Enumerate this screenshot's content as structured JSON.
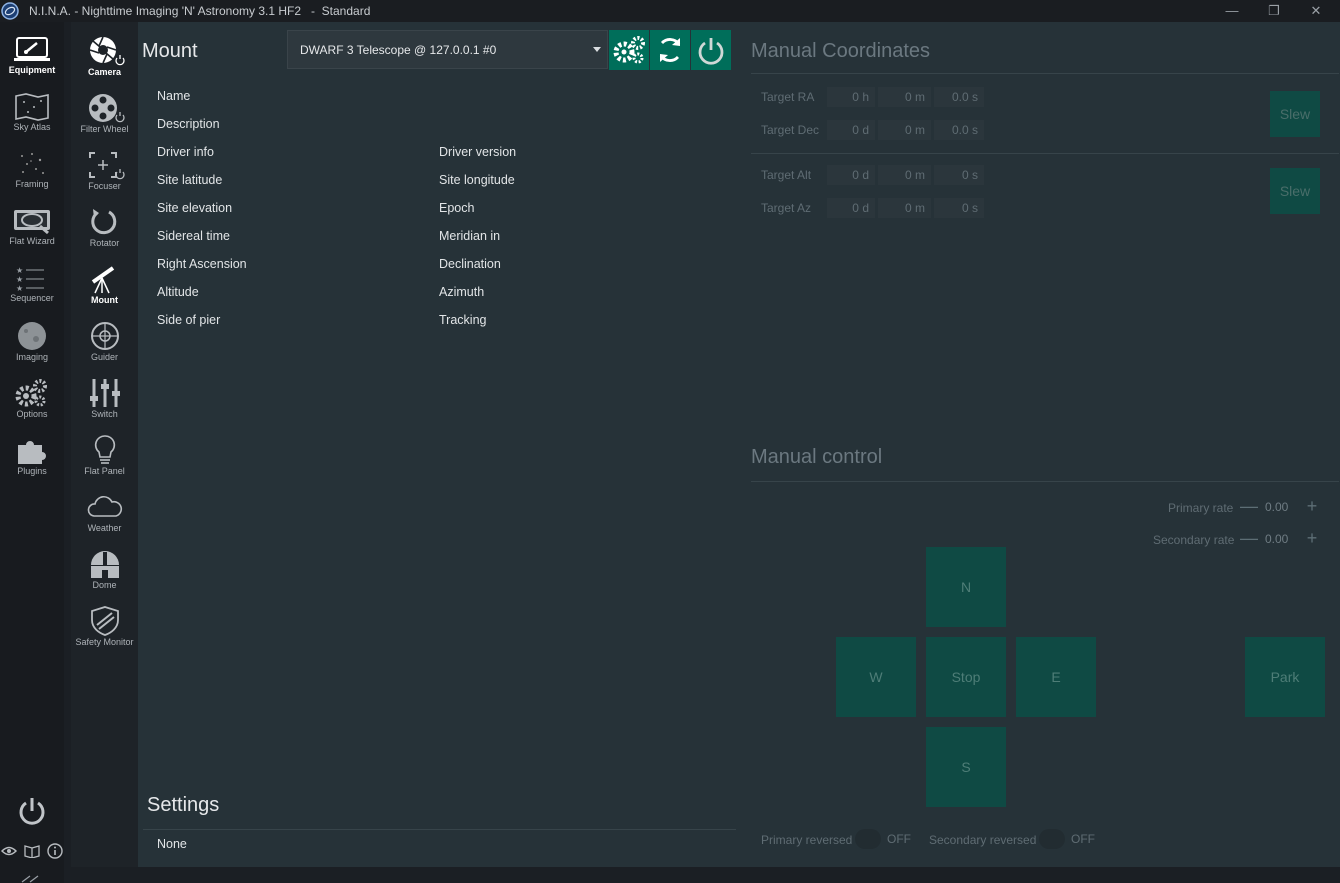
{
  "window": {
    "title": "N.I.N.A. - Nighttime Imaging 'N' Astronomy 3.1 HF2   -  Standard",
    "minimize": "—",
    "maximize": "❐",
    "close": "✕"
  },
  "nav_primary": [
    {
      "label": "Equipment",
      "icon": "equipment-icon",
      "active": true
    },
    {
      "label": "Sky Atlas",
      "icon": "sky-atlas-icon"
    },
    {
      "label": "Framing",
      "icon": "framing-icon"
    },
    {
      "label": "Flat Wizard",
      "icon": "flat-wizard-icon"
    },
    {
      "label": "Sequencer",
      "icon": "sequencer-icon"
    },
    {
      "label": "Imaging",
      "icon": "imaging-icon"
    },
    {
      "label": "Options",
      "icon": "options-icon"
    },
    {
      "label": "Plugins",
      "icon": "plugins-icon"
    }
  ],
  "nav_equipment": [
    {
      "label": "Camera",
      "icon": "camera-icon"
    },
    {
      "label": "Filter Wheel",
      "icon": "filter-wheel-icon"
    },
    {
      "label": "Focuser",
      "icon": "focuser-icon"
    },
    {
      "label": "Rotator",
      "icon": "rotator-icon"
    },
    {
      "label": "Mount",
      "icon": "telescope-icon",
      "active": true
    },
    {
      "label": "Guider",
      "icon": "guider-icon"
    },
    {
      "label": "Switch",
      "icon": "switch-icon"
    },
    {
      "label": "Flat Panel",
      "icon": "flat-panel-icon"
    },
    {
      "label": "Weather",
      "icon": "weather-icon"
    },
    {
      "label": "Dome",
      "icon": "dome-icon"
    },
    {
      "label": "Safety Monitor",
      "icon": "safety-monitor-icon"
    }
  ],
  "mount": {
    "header": "Mount",
    "device": "DWARF 3 Telescope @ 127.0.0.1 #0",
    "info_left": [
      "Name",
      "Description",
      "Driver info",
      "Site latitude",
      "Site elevation",
      "Sidereal time",
      "Right Ascension",
      "Altitude",
      "Side of pier"
    ],
    "info_right": [
      "Driver version",
      "Site longitude",
      "Epoch",
      "Meridian in",
      "Declination",
      "Azimuth",
      "Tracking"
    ]
  },
  "settings": {
    "header": "Settings",
    "value": "None"
  },
  "manual_coordinates": {
    "header": "Manual Coordinates",
    "target_ra": {
      "label": "Target RA",
      "h": "0",
      "m": "0",
      "s": "0.0"
    },
    "target_dec": {
      "label": "Target Dec",
      "d": "0",
      "m": "0",
      "s": "0.0"
    },
    "target_alt": {
      "label": "Target Alt",
      "d": "0",
      "m": "0",
      "s": "0"
    },
    "target_az": {
      "label": "Target Az",
      "d": "0",
      "m": "0",
      "s": "0"
    },
    "units": {
      "h": "h",
      "d": "d",
      "m": "m",
      "s": "s"
    },
    "slew_label": "Slew"
  },
  "manual_control": {
    "header": "Manual control",
    "primary_rate_label": "Primary rate",
    "primary_rate": "0.00",
    "secondary_rate_label": "Secondary rate",
    "secondary_rate": "0.00",
    "minus": "—",
    "plus": "+",
    "north": "N",
    "west": "W",
    "stop": "Stop",
    "east": "E",
    "south": "S",
    "park": "Park",
    "primary_reversed_label": "Primary reversed",
    "primary_reversed_state": "OFF",
    "secondary_reversed_label": "Secondary reversed",
    "secondary_reversed_state": "OFF"
  },
  "colors": {
    "accent": "#006e5a",
    "background": "#263238",
    "sidebar": "#181b1f"
  }
}
